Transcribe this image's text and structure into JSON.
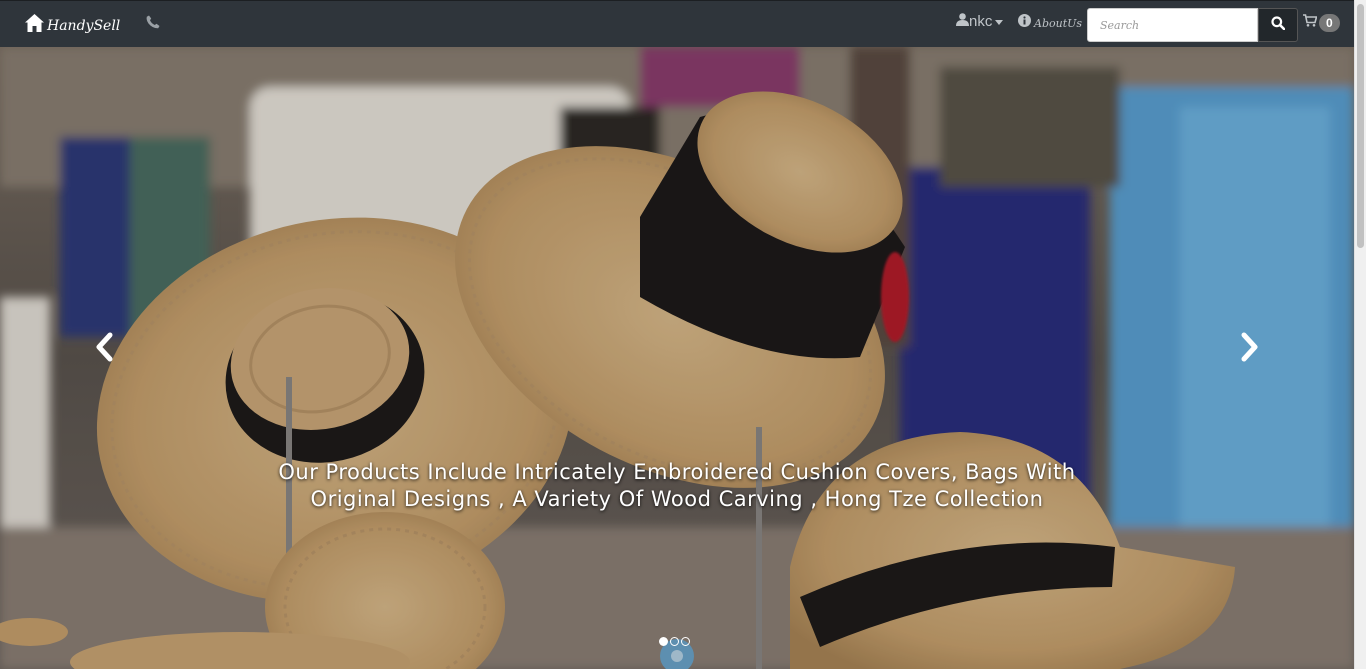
{
  "navbar": {
    "brand": {
      "label": "HandySell",
      "icon": "home-icon"
    },
    "phone": {
      "icon": "phone-icon"
    },
    "user_menu": {
      "label": "nkc",
      "icon": "user-icon"
    },
    "about": {
      "label": "AboutUs",
      "icon": "info-icon"
    },
    "search": {
      "placeholder": "Search",
      "value": "",
      "button_icon": "search-icon"
    },
    "cart": {
      "icon": "cart-icon",
      "count": "0"
    }
  },
  "carousel": {
    "caption": "Our Products Include Intricately Embroidered Cushion Covers, Bags With Original Designs , A Variety Of Wood Carving , Hong Tze Collection",
    "prev_icon": "chevron-left-icon",
    "next_icon": "chevron-right-icon",
    "indicators": {
      "count": 3,
      "active_index": 0
    }
  },
  "colors": {
    "navbar_bg": "#2f353b",
    "navbar_text": "#bfc4c8",
    "badge_bg": "#777777",
    "accent_circle": "#5d8fb0"
  }
}
